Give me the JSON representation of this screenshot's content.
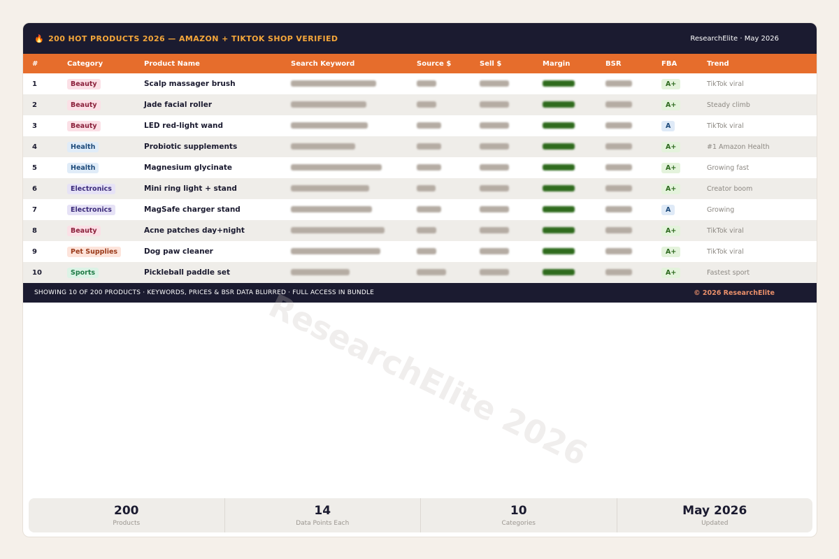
{
  "header": {
    "title_icon": "🔥",
    "title": "200 HOT PRODUCTS 2026 — AMAZON + TIKTOK SHOP VERIFIED",
    "brand": "ResearchElite · May 2026"
  },
  "columns": [
    "#",
    "Category",
    "Product Name",
    "Search Keyword",
    "Source $",
    "Sell $",
    "Margin",
    "BSR",
    "FBA",
    "Trend"
  ],
  "rows": [
    {
      "num": "1",
      "category": "Beauty",
      "cat_class": "beauty",
      "name": "Scalp massager brush",
      "fba": "A+",
      "trend": "TikTok viral"
    },
    {
      "num": "2",
      "category": "Beauty",
      "cat_class": "beauty",
      "name": "Jade facial roller",
      "fba": "A+",
      "trend": "Steady climb"
    },
    {
      "num": "3",
      "category": "Beauty",
      "cat_class": "beauty",
      "name": "LED red-light wand",
      "fba": "A",
      "trend": "TikTok viral"
    },
    {
      "num": "4",
      "category": "Health",
      "cat_class": "health",
      "name": "Probiotic supplements",
      "fba": "A+",
      "trend": "#1 Amazon Health"
    },
    {
      "num": "5",
      "category": "Health",
      "cat_class": "health",
      "name": "Magnesium glycinate",
      "fba": "A+",
      "trend": "Growing fast"
    },
    {
      "num": "6",
      "category": "Electronics",
      "cat_class": "electronics",
      "name": "Mini ring light + stand",
      "fba": "A+",
      "trend": "Creator boom"
    },
    {
      "num": "7",
      "category": "Electronics",
      "cat_class": "electronics",
      "name": "MagSafe charger stand",
      "fba": "A",
      "trend": "Growing"
    },
    {
      "num": "8",
      "category": "Beauty",
      "cat_class": "beauty",
      "name": "Acne patches day+night",
      "fba": "A+",
      "trend": "TikTok viral"
    },
    {
      "num": "9",
      "category": "Pet Supplies",
      "cat_class": "pet",
      "name": "Dog paw cleaner",
      "fba": "A+",
      "trend": "TikTok viral"
    },
    {
      "num": "10",
      "category": "Sports",
      "cat_class": "sports",
      "name": "Pickleball paddle set",
      "fba": "A+",
      "trend": "Fastest sport"
    }
  ],
  "footer": {
    "note": "SHOWING 10 OF 200 PRODUCTS  ·  KEYWORDS, PRICES & BSR DATA BLURRED  ·  FULL ACCESS IN BUNDLE",
    "copyright": "© 2026 ResearchElite"
  },
  "watermark": "ResearchElite 2026",
  "stats": [
    {
      "value": "200",
      "label": "Products"
    },
    {
      "value": "14",
      "label": "Data Points Each"
    },
    {
      "value": "10",
      "label": "Categories"
    },
    {
      "value": "May 2026",
      "label": "Updated"
    }
  ],
  "colors": {
    "header_bg": "#1b1b30",
    "accent_orange": "#e66d2c",
    "title_gold": "#f4a63a",
    "margin_green": "#2f6b1d"
  }
}
